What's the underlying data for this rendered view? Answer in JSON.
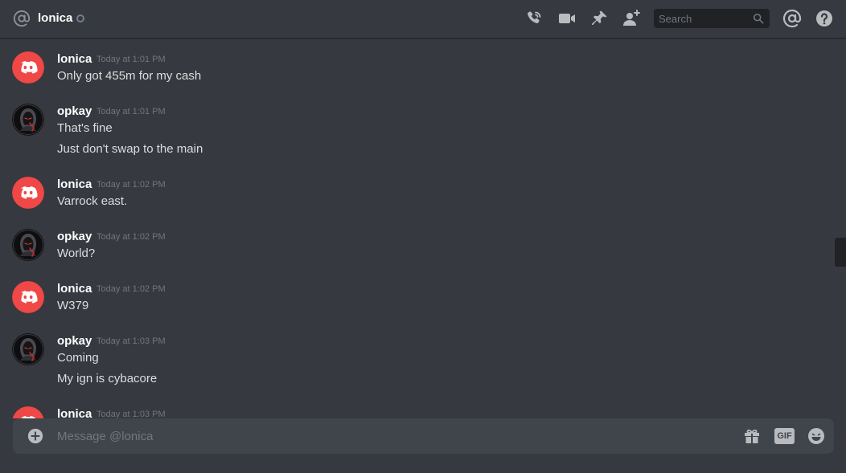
{
  "header": {
    "channel_name": "lonica",
    "search_placeholder": "Search"
  },
  "colors": {
    "background": "#36393f",
    "discord_avatar": "#f04747",
    "icon": "#b9bbbe"
  },
  "icons": {
    "at": "at-icon",
    "call": "phone-call-icon",
    "video": "video-camera-icon",
    "pin": "pin-icon",
    "add_friend": "add-friend-icon",
    "search": "search-icon",
    "mention": "mention-icon",
    "help": "help-icon"
  },
  "messages": [
    {
      "author": "lonica",
      "timestamp": "Today at 1:01 PM",
      "lines": [
        "Only got 455m for my cash"
      ]
    },
    {
      "author": "opkay",
      "timestamp": "Today at 1:01 PM",
      "lines": [
        "That's fine",
        "Just don't swap to the main"
      ]
    },
    {
      "author": "lonica",
      "timestamp": "Today at 1:02 PM",
      "lines": [
        "Varrock east."
      ]
    },
    {
      "author": "opkay",
      "timestamp": "Today at 1:02 PM",
      "lines": [
        "World?"
      ]
    },
    {
      "author": "lonica",
      "timestamp": "Today at 1:02 PM",
      "lines": [
        "W379"
      ]
    },
    {
      "author": "opkay",
      "timestamp": "Today at 1:03 PM",
      "lines": [
        "Coming",
        "My ign is cybacore"
      ]
    },
    {
      "author": "lonica",
      "timestamp": "Today at 1:03 PM",
      "lines": []
    }
  ],
  "composer": {
    "placeholder": "Message @lonica",
    "gif_label": "GIF"
  }
}
